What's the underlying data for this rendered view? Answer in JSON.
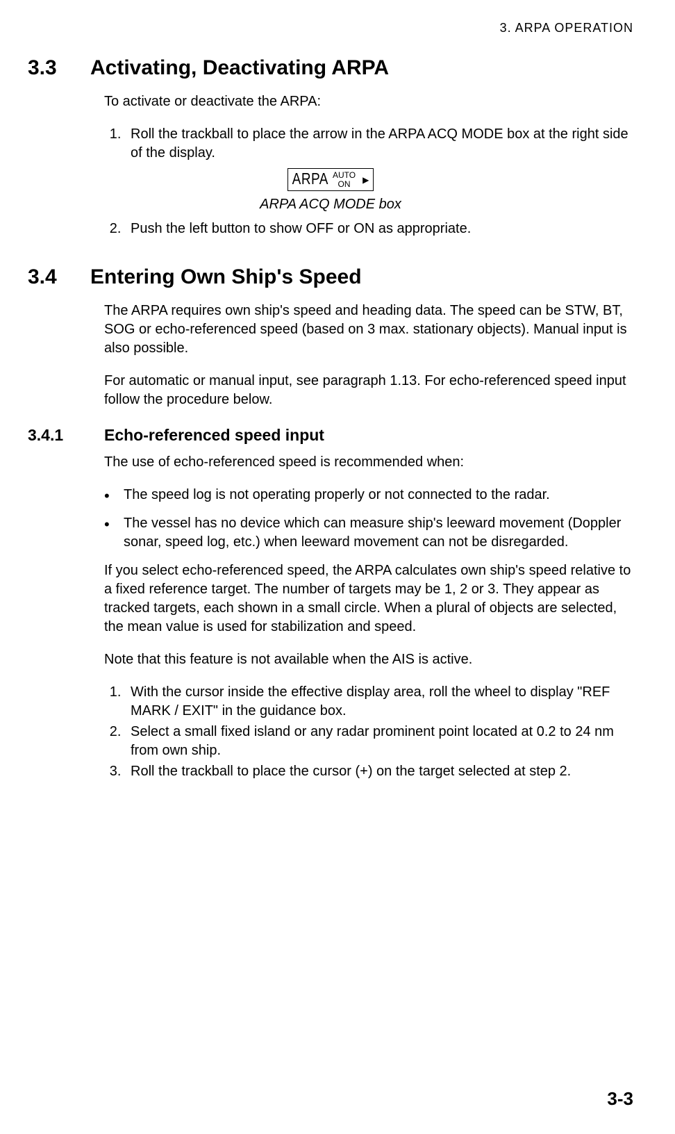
{
  "header": {
    "chapter": "3.  ARPA  OPERATION"
  },
  "section_3_3": {
    "number": "3.3",
    "title": "Activating, Deactivating ARPA",
    "intro": "To activate or deactivate the ARPA:",
    "step1": "Roll the trackball to place the arrow in the ARPA ACQ MODE box at the right side of the display.",
    "step2": "Push the left button to show OFF or ON as appropriate.",
    "figure": {
      "label": "ARPA",
      "line1": "AUTO",
      "line2": "ON",
      "arrow": "▶",
      "caption": "ARPA ACQ MODE box"
    }
  },
  "section_3_4": {
    "number": "3.4",
    "title": "Entering Own Ship's Speed",
    "para1": "The ARPA requires own ship's speed and heading data. The speed can be STW, BT, SOG or echo-referenced speed (based on 3 max. stationary objects). Manual input is also possible.",
    "para2": "For automatic or manual input, see paragraph 1.13. For echo-referenced speed input follow the procedure below."
  },
  "section_3_4_1": {
    "number": "3.4.1",
    "title": "Echo-referenced speed input",
    "intro": "The use of echo-referenced speed is recommended when:",
    "bullet1": "The speed log is not operating properly or not connected to the radar.",
    "bullet2": "The vessel has no device which can measure ship's leeward movement (Doppler sonar, speed log, etc.) when leeward movement can not be disregarded.",
    "para1": "If you select echo-referenced speed, the ARPA calculates own ship's speed relative to a fixed reference target. The number of targets may be 1, 2 or 3. They appear as tracked targets, each shown in a small circle. When a plural of objects are selected, the mean value is used for stabilization and speed.",
    "para2": "Note that this feature is not available when the AIS is active.",
    "step1": "With the cursor inside the effective display area, roll the wheel to display \"REF MARK / EXIT\" in the guidance box.",
    "step2": "Select a small fixed island or any radar prominent point located at 0.2 to 24 nm from own ship.",
    "step3": "Roll the trackball to place the cursor (+) on the target selected at step 2."
  },
  "footer": {
    "page": "3-3"
  }
}
